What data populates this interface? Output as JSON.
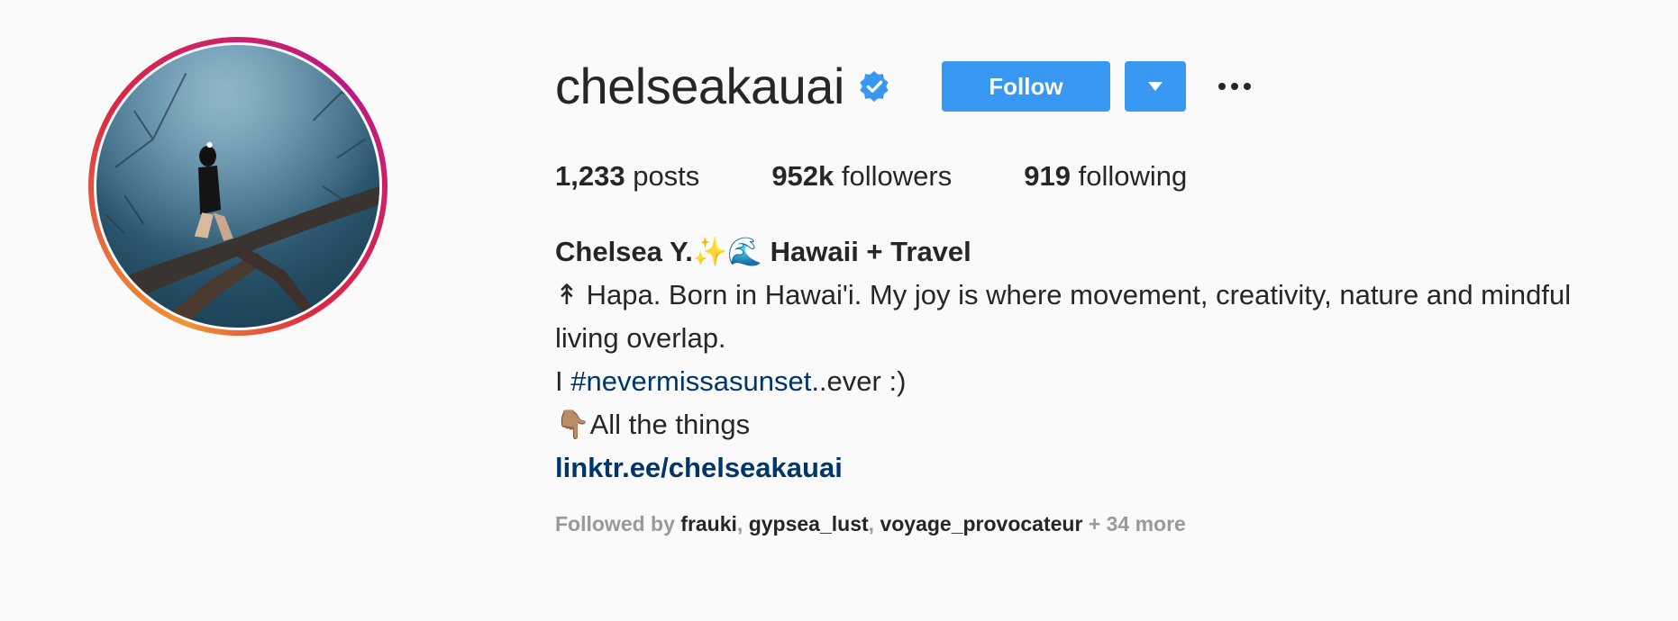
{
  "profile": {
    "username": "chelseakauai",
    "follow_label": "Follow"
  },
  "stats": {
    "posts_count": "1,233",
    "posts_label": "posts",
    "followers_count": "952k",
    "followers_label": "followers",
    "following_count": "919",
    "following_label": "following"
  },
  "bio": {
    "name": "Chelsea Y.✨🌊 Hawaii + Travel",
    "line1": "↟ Hapa. Born in Hawai'i. My joy is where movement, creativity, nature and mindful",
    "line2": "living overlap.",
    "line3_prefix": "I ",
    "hashtag": "#nevermissasunset",
    "line3_suffix": "..ever :)",
    "line4": "👇🏽All the things",
    "link": "linktr.ee/chelseakauai"
  },
  "followed_by": {
    "label": "Followed by",
    "names": [
      "frauki",
      "gypsea_lust",
      "voyage_provocateur"
    ],
    "more": "+ 34 more"
  },
  "icons": {
    "verified": "verified-badge-icon",
    "dropdown": "caret-down-icon",
    "more": "more-options-icon"
  },
  "colors": {
    "accent": "#3897f0",
    "link": "#003569",
    "verified": "#3897f0"
  }
}
